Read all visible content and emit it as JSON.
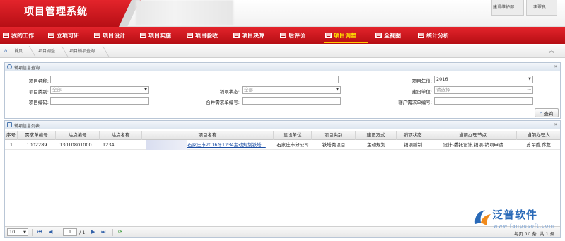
{
  "app": {
    "title": "项目管理系统",
    "header_buttons": [
      {
        "label": "建设维护部",
        "icon": "department-icon"
      },
      {
        "label": "李翠良",
        "icon": "user-icon"
      }
    ]
  },
  "mainnav": [
    {
      "label": "我的工作",
      "active": false
    },
    {
      "label": "立项可研",
      "active": false
    },
    {
      "label": "项目设计",
      "active": false
    },
    {
      "label": "项目实施",
      "active": false
    },
    {
      "label": "项目验收",
      "active": false
    },
    {
      "label": "项目决算",
      "active": false
    },
    {
      "label": "后评价",
      "active": false
    },
    {
      "label": "项目调整",
      "active": true
    },
    {
      "label": "全视图",
      "active": false
    },
    {
      "label": "统计分析",
      "active": false
    }
  ],
  "breadcrumb": [
    "首页",
    "项目调整",
    "项目销项查询"
  ],
  "query_panel": {
    "title": "销项信息查询",
    "fields": {
      "project_name": {
        "label": "项目名称:",
        "value": ""
      },
      "project_year": {
        "label": "项目年份:",
        "value": "2016"
      },
      "project_type": {
        "label": "项目类别:",
        "value": "全部"
      },
      "cancel_status": {
        "label": "销项状态:",
        "value": "全部"
      },
      "build_unit": {
        "label": "建设单位:",
        "placeholder": "请选择"
      },
      "project_code": {
        "label": "项目编码:",
        "value": ""
      },
      "merge_req_no": {
        "label": "合并需求单编号:",
        "value": ""
      },
      "customer_req_no": {
        "label": "客户需求单编号:",
        "value": ""
      }
    },
    "query_button": "查询"
  },
  "list_panel": {
    "title": "销项信息列表",
    "columns": [
      "序号",
      "需求单编号",
      "站点编号",
      "站点名称",
      "项目名称",
      "建设单位",
      "项目类别",
      "建设方式",
      "销项状态",
      "当前办理节点",
      "当前办理人"
    ],
    "rows": [
      {
        "seq": "1",
        "req_no": "1002289",
        "site_code": "13010801000...",
        "site_name": "1234",
        "project_name": "石家庄市2016年1234主动规划铁塔...",
        "build_unit": "石家庄市分公司",
        "project_type": "铁塔类项目",
        "build_mode": "主动规划",
        "status": "销项编制",
        "current_node": "设计-委托设计,销项-销项申请",
        "handler": "苏军香,乔龙"
      }
    ],
    "pager": {
      "page_size": "10",
      "current_page": "1",
      "total_pages": "/ 1",
      "info": "每页 10 条, 共 1 条"
    }
  },
  "watermark": {
    "brand": "泛普软件",
    "url": "www.fanpusoft.com"
  }
}
